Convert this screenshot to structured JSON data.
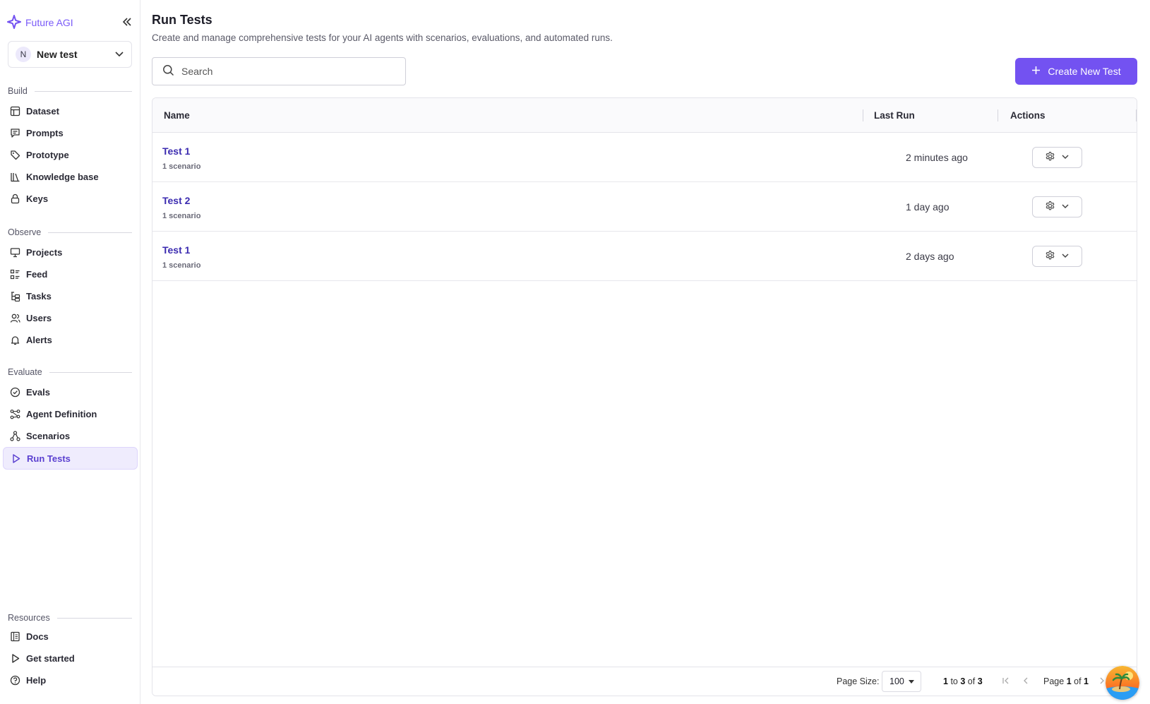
{
  "brand": {
    "name": "Future AGI",
    "accent": "#7352f1"
  },
  "workspace": {
    "initial": "N",
    "name": "New test"
  },
  "sidebar": {
    "sections": [
      {
        "label": "Build",
        "items": [
          "Dataset",
          "Prompts",
          "Prototype",
          "Knowledge base",
          "Keys"
        ]
      },
      {
        "label": "Observe",
        "items": [
          "Projects",
          "Feed",
          "Tasks",
          "Users",
          "Alerts"
        ]
      },
      {
        "label": "Evaluate",
        "items": [
          "Evals",
          "Agent Definition",
          "Scenarios",
          "Run Tests"
        ]
      },
      {
        "label": "Resources",
        "items": [
          "Docs",
          "Get started",
          "Help"
        ]
      }
    ],
    "active": "Run Tests"
  },
  "page": {
    "title": "Run Tests",
    "subtitle": "Create and manage comprehensive tests for your AI agents with scenarios, evaluations, and automated runs."
  },
  "search": {
    "placeholder": "Search"
  },
  "create_button": {
    "label": "Create New Test"
  },
  "table": {
    "columns": [
      "Name",
      "Last Run",
      "Actions"
    ],
    "rows": [
      {
        "name": "Test 1",
        "sub": "1 scenario",
        "last_run": "2 minutes ago"
      },
      {
        "name": "Test 2",
        "sub": "1 scenario",
        "last_run": "1 day ago"
      },
      {
        "name": "Test 1",
        "sub": "1 scenario",
        "last_run": "2 days ago"
      }
    ]
  },
  "pagination": {
    "page_size_label": "Page Size:",
    "page_size": "100",
    "range_start": "1",
    "range_to": "to",
    "range_end": "3",
    "range_of": "of",
    "total": "3",
    "page_word": "Page",
    "page_current": "1",
    "page_of": "of",
    "page_total": "1"
  }
}
